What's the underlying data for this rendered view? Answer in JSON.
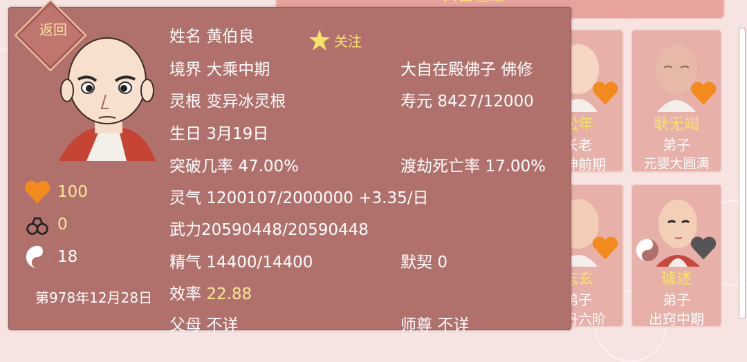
{
  "background": {
    "top_tab_label": "大自在殿",
    "cards": [
      {
        "name": "松年",
        "rank": "长老",
        "realm": "化神前期",
        "heart": "orange"
      },
      {
        "name": "耿无竭",
        "rank": "弟子",
        "realm": "元婴大圆满",
        "heart": "orange"
      },
      {
        "name": "志玄",
        "rank": "弟子",
        "realm": "金丹六阶",
        "heart": "orange"
      },
      {
        "name": "璩述",
        "rank": "弟子",
        "realm": "出窍中期",
        "heart": "gray"
      }
    ]
  },
  "panel": {
    "back_label": "返回",
    "follow_label": "关注",
    "left_stats": {
      "favor": "100",
      "shackles": "0",
      "taiji": "18",
      "date": "第978年12月28日"
    },
    "info": {
      "name_label": "姓名",
      "name_value": "黄伯良",
      "realm_label": "境界",
      "realm_value": "大乘中期",
      "sect_text": "大自在殿佛子",
      "cult_type": "佛修",
      "root_label": "灵根",
      "root_value": "变异冰灵根",
      "life_label": "寿元",
      "life_value": "8427/12000",
      "birthday_label": "生日",
      "birthday_value": "3月19日",
      "breakthrough_label": "突破几率",
      "breakthrough_value": "47.00%",
      "tribulation_label": "渡劫死亡率",
      "tribulation_value": "17.00%",
      "qi_label": "灵气",
      "qi_value": "1200107/2000000 +3.35/日",
      "force_label": "武力",
      "force_value": "20590448/20590448",
      "essence_label": "精气",
      "essence_value": "14400/14400",
      "tacit_label": "默契",
      "tacit_value": "0",
      "efficiency_label": "效率",
      "efficiency_value": "22.88",
      "parents_label": "父母",
      "parents_value": "不详",
      "master_label": "师尊",
      "master_value": "不详"
    }
  },
  "colors": {
    "panel_bg": "#b0716c",
    "accent_yellow": "#fbe98f",
    "heart_orange": "#f28a1c"
  },
  "icons": [
    "back-icon",
    "star-icon",
    "heart-icon",
    "shackles-icon",
    "taiji-icon"
  ]
}
